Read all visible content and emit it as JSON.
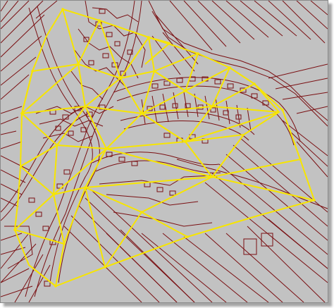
{
  "map": {
    "background_color": "#c2c2c2",
    "parcel_line_color": "#7a0f12",
    "triangulation_color": "#f7e500",
    "frame_shadow": true
  }
}
